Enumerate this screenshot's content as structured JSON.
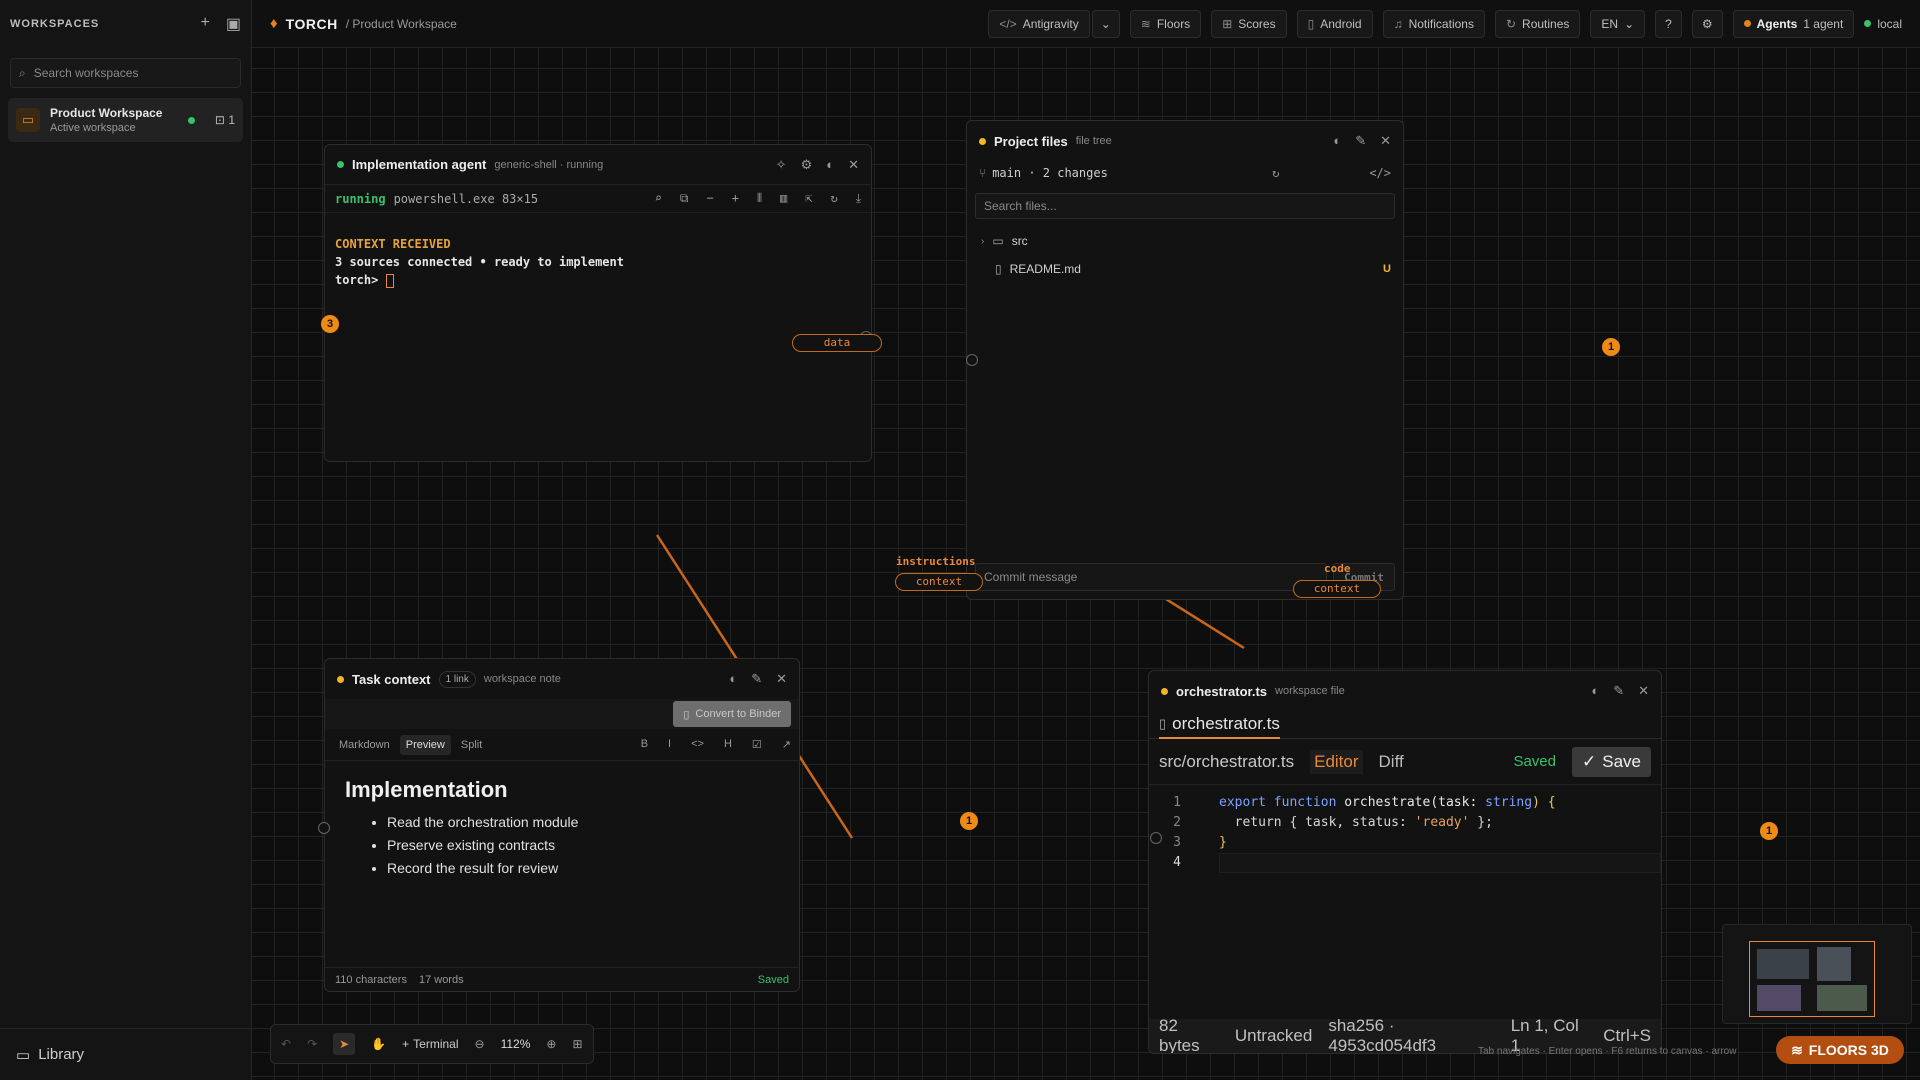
{
  "sidebar": {
    "title": "WORKSPACES",
    "search_placeholder": "Search workspaces",
    "workspace": {
      "name": "Product Workspace",
      "status": "Active workspace",
      "count": "1"
    },
    "library_label": "Library"
  },
  "topbar": {
    "brand": "TORCH",
    "breadcrumb": "/ Product Workspace",
    "buttons": {
      "antigravity": "Antigravity",
      "floors": "Floors",
      "scores": "Scores",
      "android": "Android",
      "notifications": "Notifications",
      "routines": "Routines",
      "lang": "EN"
    },
    "agents_label": "Agents",
    "agents_count": "1 agent",
    "local_label": "local"
  },
  "agent_panel": {
    "title": "Implementation agent",
    "meta": "generic-shell · running",
    "status": "running",
    "process": "powershell.exe 83×15",
    "lines": [
      "CONTEXT RECEIVED",
      "3 sources connected • ready to implement",
      "torch>"
    ],
    "badge": "3"
  },
  "files_panel": {
    "title": "Project files",
    "meta": "file tree",
    "branch": "main · 2 changes",
    "search_placeholder": "Search files...",
    "items": [
      {
        "name": "src",
        "type": "folder",
        "status": ""
      },
      {
        "name": "README.md",
        "type": "file",
        "status": "U"
      }
    ],
    "commit_placeholder": "Commit message",
    "commit_label": "Commit",
    "badge": "1"
  },
  "note_panel": {
    "title": "Task context",
    "link_badge": "1 link",
    "meta": "workspace note",
    "convert_label": "Convert to Binder",
    "tabs": [
      "Markdown",
      "Preview",
      "Split"
    ],
    "active_tab": "Preview",
    "format_tools": [
      "B",
      "I",
      "<>",
      "H",
      "☑",
      "↗"
    ],
    "heading": "Implementation",
    "bullets": [
      "Read the orchestration module",
      "Preserve existing contracts",
      "Record the result for review"
    ],
    "characters": "110 characters",
    "words": "17 words",
    "saved": "Saved",
    "badge": "1"
  },
  "code_panel": {
    "title": "orchestrator.ts",
    "meta": "workspace file",
    "tab": "orchestrator.ts",
    "path": "src/orchestrator.ts",
    "modes": [
      "Editor",
      "Diff"
    ],
    "saved": "Saved",
    "save_label": "Save",
    "line_numbers": [
      "1",
      "2",
      "3",
      "4"
    ],
    "code_l1": {
      "kw": "export function",
      "fn": " orchestrate(task: ",
      "ty": "string",
      "end": ") {"
    },
    "code_l2": {
      "pre": "  return { task, status: ",
      "str": "'ready'",
      "post": " };"
    },
    "code_l3": "}",
    "footer": [
      "82 bytes",
      "Untracked",
      "sha256 · 4953cd054df3",
      "Ln 1, Col 1",
      "Ctrl+S"
    ],
    "badge": "1"
  },
  "edges": {
    "data": "data",
    "instructions": "instructions",
    "context1": "context",
    "code": "code",
    "context2": "context"
  },
  "bottom_toolbar": {
    "terminal": "Terminal",
    "zoom": "112%"
  },
  "hint": "Tab navigates · Enter opens · F6 returns to canvas · arrow",
  "floors3d": "FLOORS 3D",
  "colors": {
    "accent": "#ee8a16",
    "ok": "#37c26b",
    "warn": "#f2b628"
  }
}
